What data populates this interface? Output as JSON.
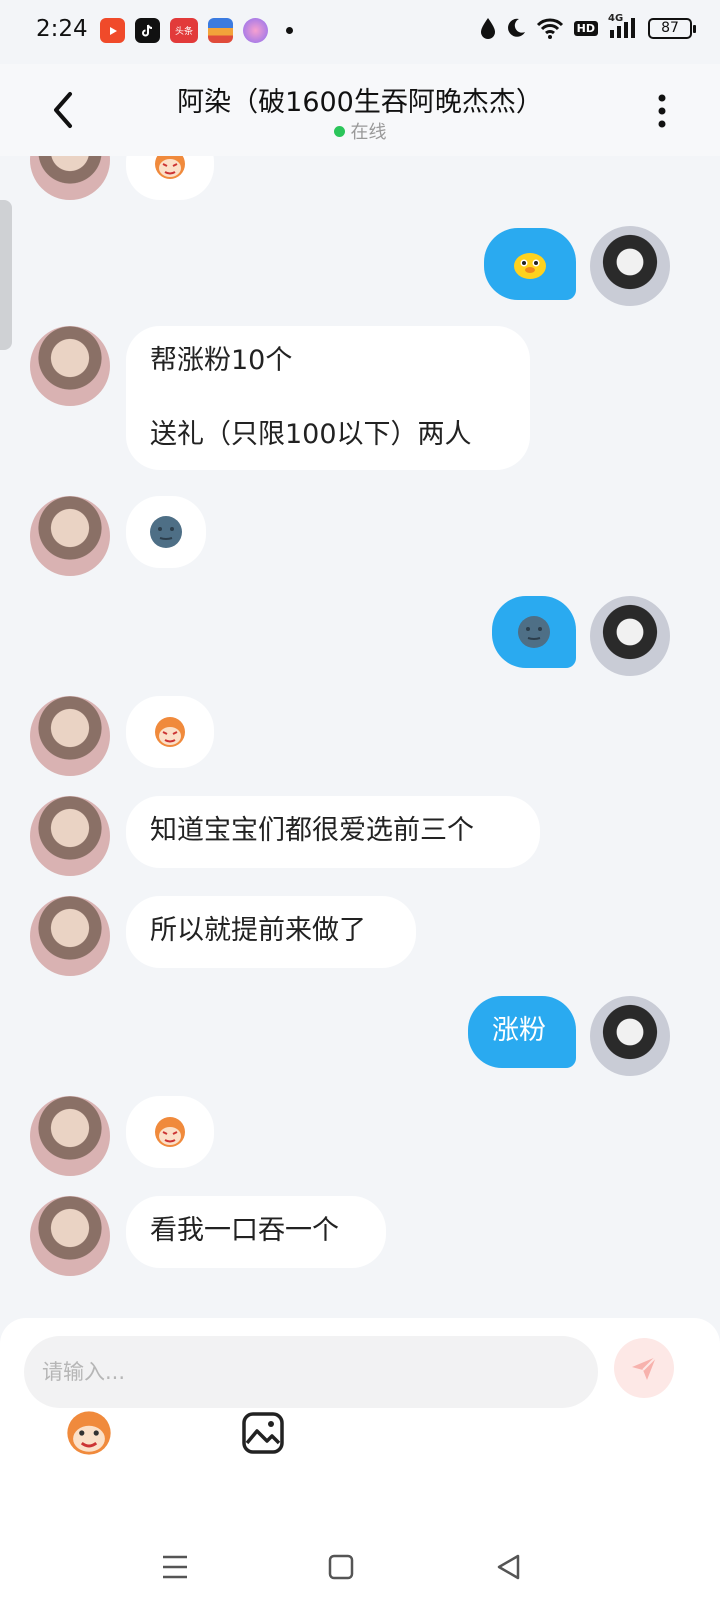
{
  "status_bar": {
    "time": "2:24",
    "apps": [
      {
        "icon": "video-app-icon",
        "color": "#f04a2a",
        "label": ""
      },
      {
        "icon": "tiktok-app-icon",
        "color": "#111111",
        "label": ""
      },
      {
        "icon": "toutiao-app-icon",
        "color": "#e23a3a",
        "label": "头条"
      },
      {
        "icon": "wallet-app-icon",
        "color": "#3b7be0",
        "label": ""
      },
      {
        "icon": "bubble-app-icon",
        "color": "#e96ab3",
        "label": ""
      }
    ],
    "hd_label": "HD",
    "network_label": "4G",
    "battery": "87"
  },
  "header": {
    "title": "阿染（破1600生吞阿晚杰杰）",
    "status": "在线"
  },
  "messages": [
    {
      "side": "in",
      "type": "emoji",
      "emoji": "monkey"
    },
    {
      "side": "out",
      "type": "emoji",
      "emoji": "chick"
    },
    {
      "side": "in",
      "type": "text",
      "lines": [
        "帮涨粉10个",
        "",
        "送礼（只限100以下）两人"
      ]
    },
    {
      "side": "in",
      "type": "emoji",
      "emoji": "moon"
    },
    {
      "side": "out",
      "type": "emoji",
      "emoji": "moon"
    },
    {
      "side": "in",
      "type": "emoji",
      "emoji": "monkey"
    },
    {
      "side": "in",
      "type": "text",
      "text": "知道宝宝们都很爱选前三个"
    },
    {
      "side": "in",
      "type": "text",
      "text": "所以就提前来做了"
    },
    {
      "side": "out",
      "type": "text",
      "text": "涨粉"
    },
    {
      "side": "in",
      "type": "emoji",
      "emoji": "monkey"
    },
    {
      "side": "in",
      "type": "text",
      "text": "看我一口吞一个"
    }
  ],
  "composer": {
    "placeholder": "请输入...",
    "value": ""
  },
  "colors": {
    "outgoing_bubble": "#2aaaf0",
    "incoming_bubble": "#ffffff",
    "online_dot": "#2bc55a",
    "send_button": "#fde8e6"
  }
}
